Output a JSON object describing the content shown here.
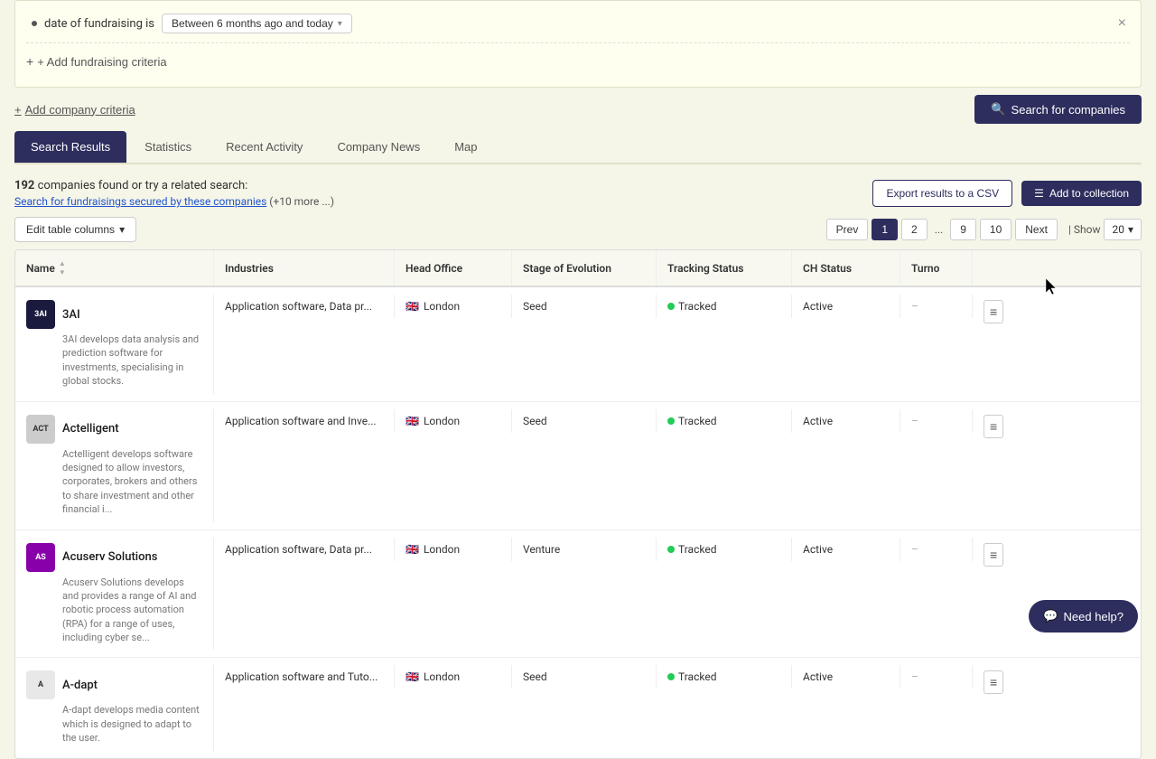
{
  "filter": {
    "label": "date of fundraising is",
    "value": "Between 6 months ago and today",
    "chevron": "▾"
  },
  "add_fundraising": {
    "label": "+ Add fundraising criteria"
  },
  "add_company": {
    "label": "Add company criteria"
  },
  "search_btn": {
    "label": "Search for companies",
    "icon": "🔍"
  },
  "tabs": [
    {
      "label": "Search Results",
      "active": true
    },
    {
      "label": "Statistics",
      "active": false
    },
    {
      "label": "Recent Activity",
      "active": false
    },
    {
      "label": "Company News",
      "active": false
    },
    {
      "label": "Map",
      "active": false
    }
  ],
  "results": {
    "count": "192",
    "count_label": "companies",
    "found_text": "found or try a related search:",
    "search_link": "Search for fundraisings secured by these companies",
    "more_text": "(+10 more ...)"
  },
  "export_btn": "Export results to a CSV",
  "collection_btn": "Add to collection",
  "edit_columns_btn": "Edit table columns",
  "pagination": {
    "prev": "Prev",
    "pages": [
      "1",
      "2",
      "...",
      "9",
      "10"
    ],
    "next": "Next",
    "show_label": "| Show",
    "show_value": "20"
  },
  "columns": [
    {
      "label": "Name",
      "sortable": true
    },
    {
      "label": "Industries",
      "sortable": false
    },
    {
      "label": "Head Office",
      "sortable": false
    },
    {
      "label": "Stage of Evolution",
      "sortable": false
    },
    {
      "label": "Tracking Status",
      "sortable": false
    },
    {
      "label": "CH Status",
      "sortable": false
    },
    {
      "label": "Turno",
      "sortable": false
    },
    {
      "label": "",
      "sortable": false
    }
  ],
  "companies": [
    {
      "name": "3AI",
      "logo_bg": "#1a1a3e",
      "logo_text": "3AI",
      "industries": "Application software, Data pr...",
      "head_office_flag": "🇬🇧",
      "head_office": "London",
      "stage": "Seed",
      "tracking": "Tracked",
      "ch_status": "Active",
      "turnover": "–",
      "description": "3AI develops data analysis and prediction software for investments, specialising in global stocks."
    },
    {
      "name": "Actelligent",
      "logo_bg": "#cccccc",
      "logo_text": "ACT",
      "industries": "Application software and Inve...",
      "head_office_flag": "🇬🇧",
      "head_office": "London",
      "stage": "Seed",
      "tracking": "Tracked",
      "ch_status": "Active",
      "turnover": "–",
      "description": "Actelligent develops software designed to allow investors, corporates, brokers and others to share investment and other financial i..."
    },
    {
      "name": "Acuserv Solutions",
      "logo_bg": "#8800aa",
      "logo_text": "AS",
      "industries": "Application software, Data pr...",
      "head_office_flag": "🇬🇧",
      "head_office": "London",
      "stage": "Venture",
      "tracking": "Tracked",
      "ch_status": "Active",
      "turnover": "–",
      "description": "Acuserv Solutions develops and provides a range of AI and robotic process automation (RPA) for a range of uses, including cyber se..."
    },
    {
      "name": "A-dapt",
      "logo_bg": "#e8e8e8",
      "logo_text": "A",
      "industries": "Application software and Tuto...",
      "head_office_flag": "🇬🇧",
      "head_office": "London",
      "stage": "Seed",
      "tracking": "Tracked",
      "ch_status": "Active",
      "turnover": "–",
      "description": "A-dapt develops media content which is designed to adapt to the user."
    }
  ],
  "need_help": "Need help?"
}
